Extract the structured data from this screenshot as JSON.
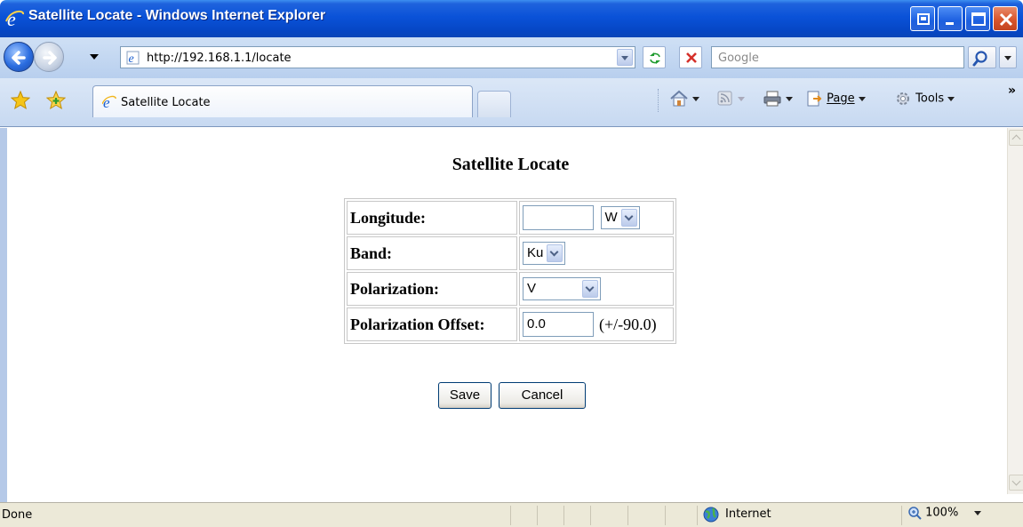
{
  "window": {
    "title": "Satellite Locate - Windows Internet Explorer"
  },
  "navbar": {
    "url": "http://192.168.1.1/locate",
    "search_placeholder": "Google"
  },
  "tabs": [
    {
      "label": "Satellite Locate",
      "active": true
    }
  ],
  "commandbar": {
    "page_label": "Page",
    "tools_label": "Tools",
    "more_label": "»"
  },
  "page": {
    "heading": "Satellite Locate",
    "rows": [
      {
        "label": "Longitude:",
        "input_value": "",
        "select_value": "W"
      },
      {
        "label": "Band:",
        "select_value": "Ku"
      },
      {
        "label": "Polarization:",
        "select_value": "V"
      },
      {
        "label": "Polarization Offset:",
        "input_value": "0.0",
        "hint": "(+/-90.0)"
      }
    ],
    "save_label": "Save",
    "cancel_label": "Cancel"
  },
  "statusbar": {
    "status": "Done",
    "zone": "Internet",
    "zoom": "100%"
  },
  "colors": {
    "titlebar": "#0a52d8",
    "chrome": "#c7d9f1",
    "statusbar": "#ece9d8"
  },
  "icons": [
    "ie-icon",
    "back-icon",
    "forward-icon",
    "page-icon",
    "refresh-icon",
    "stop-icon",
    "search-icon",
    "favorites-star-icon",
    "add-favorites-icon",
    "home-icon",
    "feeds-icon",
    "print-icon",
    "page-menu-icon",
    "tools-gear-icon",
    "globe-icon",
    "zoom-icon"
  ]
}
